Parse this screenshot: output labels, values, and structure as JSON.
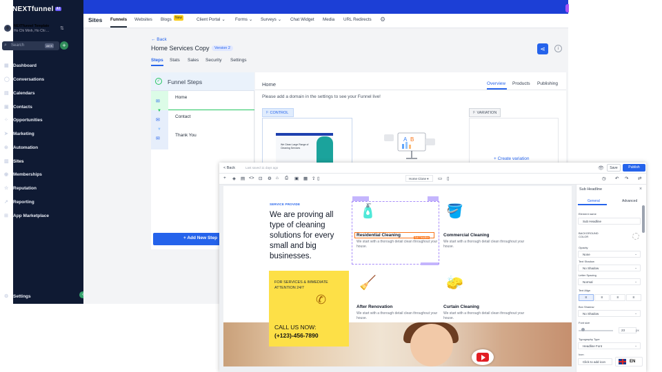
{
  "sidebar": {
    "brand": "NEXTfunnel",
    "brand_badge": "AI",
    "location_name": "NEXTfunnel Template",
    "location_sub": "Ho Chi Minh, Ho Chi ...",
    "search_placeholder": "Search",
    "search_shortcut": "ctrl K",
    "items": [
      {
        "label": "Dashboard",
        "icon": "dashboard-icon",
        "glyph": "▦"
      },
      {
        "label": "Conversations",
        "icon": "chat-icon",
        "glyph": "◯"
      },
      {
        "label": "Calendars",
        "icon": "calendar-icon",
        "glyph": "▤"
      },
      {
        "label": "Contacts",
        "icon": "contacts-icon",
        "glyph": "▣"
      },
      {
        "label": "Opportunities",
        "icon": "opportunities-icon",
        "glyph": "⁘"
      },
      {
        "label": "Marketing",
        "icon": "send-icon",
        "glyph": "➤"
      },
      {
        "label": "Automation",
        "icon": "automation-icon",
        "glyph": "⊛"
      },
      {
        "label": "Sites",
        "icon": "sites-icon",
        "glyph": "▥"
      },
      {
        "label": "Memberships",
        "icon": "memberships-icon",
        "glyph": "◉"
      },
      {
        "label": "Reputation",
        "icon": "star-icon",
        "glyph": "☆"
      },
      {
        "label": "Reporting",
        "icon": "chart-icon",
        "glyph": "↗"
      },
      {
        "label": "App Marketplace",
        "icon": "grid-icon",
        "glyph": "⊞"
      }
    ],
    "settings_label": "Settings"
  },
  "topnav": {
    "section_title": "Sites",
    "tabs": [
      "Funnels",
      "Websites",
      "Blogs",
      "Client Portal",
      "Forms",
      "Surveys",
      "Chat Widget",
      "Media",
      "URL Redirects"
    ],
    "new_badge": "New",
    "active_tab": "Funnels"
  },
  "funnel": {
    "back_label": "← Back",
    "name": "Home Services Copy",
    "version": "Version 2",
    "tabs": [
      "Steps",
      "Stats",
      "Sales",
      "Security",
      "Settings"
    ],
    "steps_title": "Funnel Steps",
    "steps": [
      "Home",
      "Contact",
      "Thank You"
    ],
    "add_step_label": "+ Add New Step"
  },
  "step_detail": {
    "title": "Home",
    "tabs": [
      "Overview",
      "Products",
      "Publishing"
    ],
    "domain_message": "Please add a domain in the settings to see your Funnel live!",
    "control_label": "CONTROL",
    "variation_label": "VARIATION",
    "create_variation": "+ Create variation",
    "thumb_text": "We Clean Large Range of Cleaning Services"
  },
  "builder": {
    "back_label": "< Back",
    "saved_text": "Last saved 11 days ago",
    "save_label": "Save",
    "publish_label": "Publish",
    "page_select": "Home Clone",
    "canvas": {
      "pill": "SERVICE PROVIDE",
      "headline": "We are proving all type of cleaning solutions for every small and big businesses.",
      "cta_title": "FOR SERVICES & IMMEDIATE ATTENTION 24/7",
      "call_label": "CALL US NOW:",
      "phone": "(+123)-456-7890",
      "headline_tag": "Sub Headline",
      "services": [
        {
          "title": "Residential Cleaning",
          "desc": "We start with a thorough detail clean throughout your house.",
          "icon": "cleaning-supplies-icon",
          "glyph": "🧴"
        },
        {
          "title": "Commercial Cleaning",
          "desc": "We start with a thorough detail clean throughout your house.",
          "icon": "bucket-icon",
          "glyph": "🪣"
        },
        {
          "title": "After Renovation",
          "desc": "We start with a thorough detail clean throughout your house.",
          "icon": "vacuum-icon",
          "glyph": "🧹"
        },
        {
          "title": "Curtain Cleaning",
          "desc": "We start with a thorough detail clean throughout your house.",
          "icon": "sponge-icon",
          "glyph": "🧽"
        }
      ]
    },
    "settings": {
      "title": "Sub Headline",
      "tabs": [
        "General",
        "Advanced"
      ],
      "element_name_label": "Element name",
      "element_name_value": "Sub Headline",
      "bg_color_label": "BACKGROUND COLOR",
      "opacity_label": "Opacity",
      "opacity_value": "None",
      "text_shadow_label": "Text Shadow",
      "text_shadow_value": "No Shadow",
      "letter_spacing_label": "Letter Spacing",
      "letter_spacing_value": "Normal",
      "text_align_label": "Text Align",
      "box_shadow_label": "Box Shadow",
      "box_shadow_value": "No Shadow",
      "font_size_label": "Font size",
      "font_size_value": "23",
      "font_size_unit": "px",
      "typography_label": "Typography Type",
      "typography_value": "Headline Font",
      "icon_label": "Icon",
      "icon_placeholder": "Click to add icon",
      "language": "EN"
    }
  },
  "colors": {
    "accent": "#2563eb",
    "sidebar_bg": "#0f1a33",
    "cta_yellow": "#fde047"
  }
}
